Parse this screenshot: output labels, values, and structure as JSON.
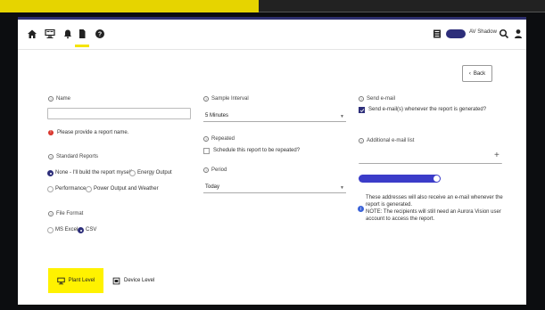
{
  "topbar": {
    "icons": [
      "home-icon",
      "dashboard-icon",
      "bell-icon",
      "document-icon",
      "help-icon"
    ],
    "active_icon": "document-icon",
    "right_icons": [
      "device-icon",
      "search-icon",
      "user-icon"
    ],
    "shadow_label": "AV Shadow",
    "accent": "#f5e400",
    "brand": "#2d2e7a"
  },
  "back_button": {
    "label": "Back"
  },
  "name": {
    "label": "Name",
    "value": "",
    "error": "Please provide a report name."
  },
  "standard_reports": {
    "label": "Standard Reports",
    "options": [
      "None - I'll build the report myself.",
      "Energy Output",
      "Performance",
      "Power Output and Weather"
    ],
    "selected": "None - I'll build the report myself."
  },
  "file_format": {
    "label": "File Format",
    "options": [
      "MS Excel",
      "CSV"
    ],
    "selected": "CSV"
  },
  "sample_interval": {
    "label": "Sample Interval",
    "value": "5 Minutes"
  },
  "repeated": {
    "label": "Repeated",
    "checkbox_label": "Schedule this report to be repeated?",
    "checked": false
  },
  "period": {
    "label": "Period",
    "value": "Today"
  },
  "send_email": {
    "label": "Send e-mail",
    "checkbox_label": "Send e-mail(s) whenever the report is generated?",
    "checked": true
  },
  "additional_email": {
    "label": "Additional e-mail list",
    "value": "",
    "add_symbol": "+",
    "info": "These addresses will also receive an e-mail whenever the report is generated.\nNOTE: The recipients will still need an Aurora Vision user account to access the report."
  },
  "level_tabs": {
    "plant": "Plant Level",
    "device": "Device Level",
    "active": "Plant Level"
  }
}
